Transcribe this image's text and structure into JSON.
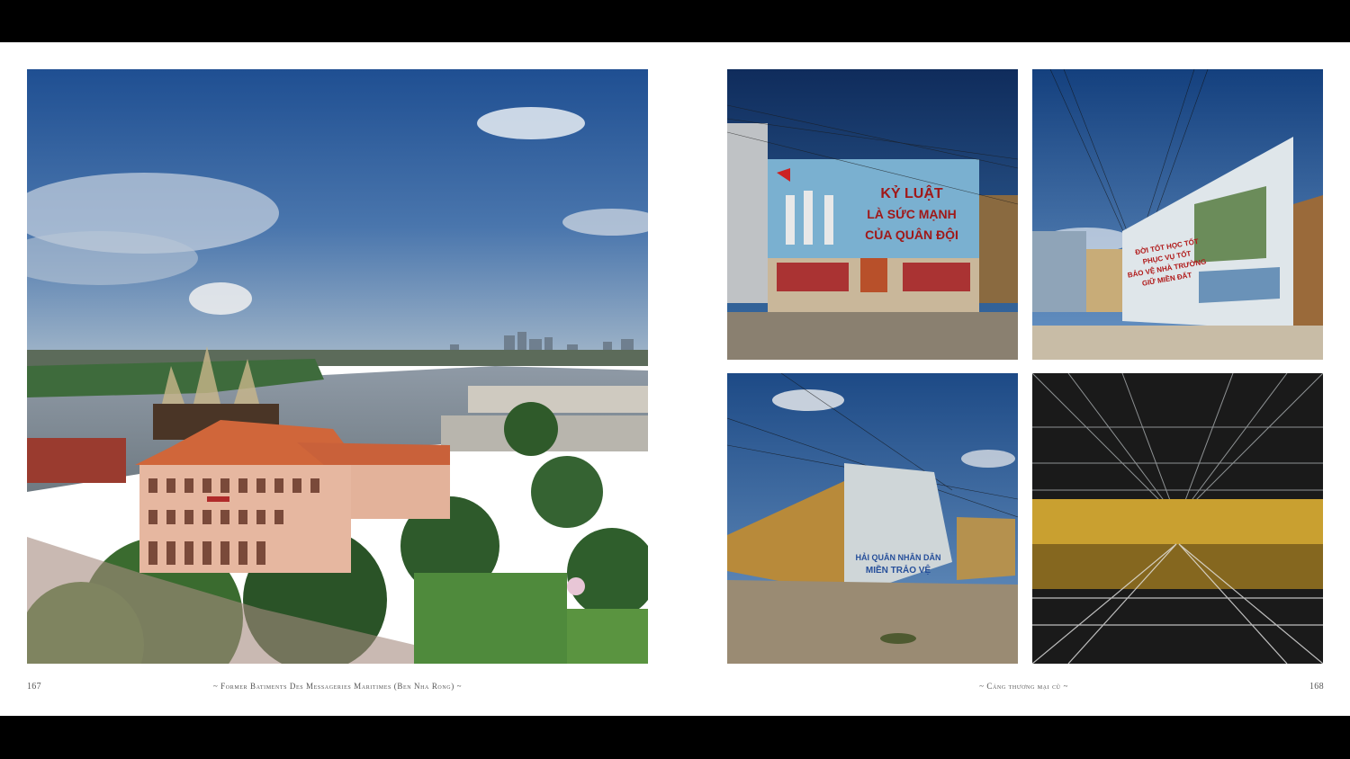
{
  "left_page": {
    "page_number": "167",
    "caption": "~ Former Batiments Des Messageries Maritimes (Ben Nha Rong) ~"
  },
  "right_page": {
    "page_number": "168",
    "caption": "~ Cảng thương mại cũ ~"
  },
  "photos": {
    "main": {
      "mural": "Main photo: riverside city view with colonial building, river, ship and skyline"
    },
    "p1": {
      "line1": "KỶ LUẬT",
      "line2": "LÀ SỨC MẠNH",
      "line3": "CỦA QUÂN ĐỘI"
    },
    "p2": {
      "line1": "ĐỜI TỐT  HỌC TỐT",
      "line2": "PHỤC VỤ TỐT",
      "line3": "BẢO VỆ NHÀ TRƯỜNG",
      "line4": "GIỮ MIỀN ĐẤT"
    },
    "p3": {
      "line1": "HẢI QUÂN NHÂN DÂN",
      "line2": "MIỀN TRẢO VỆ"
    }
  },
  "colors": {
    "sky": "#2b5a9a",
    "roof": "#d4683a",
    "building": "#e8b8a0",
    "mural_blue": "#7ab0d0",
    "warehouse_yellow": "#c9a030"
  }
}
